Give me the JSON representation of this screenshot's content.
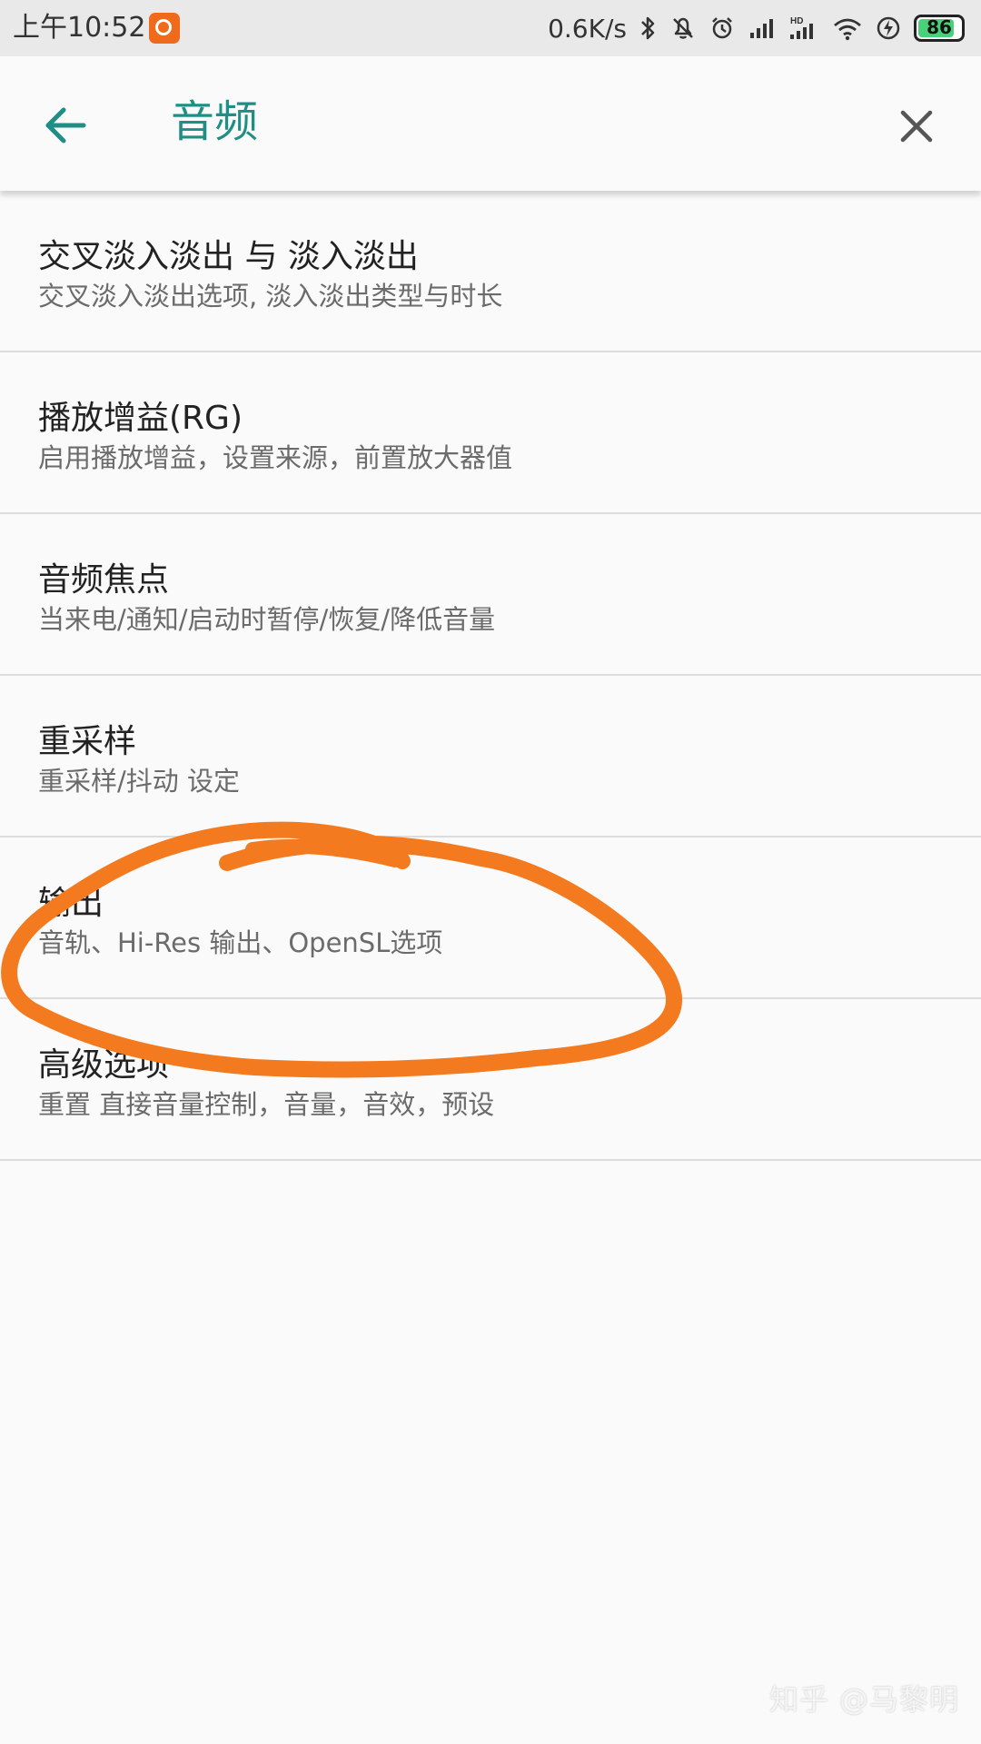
{
  "status_bar": {
    "time": "上午10:52",
    "app_icon": "mi-app-icon",
    "net_speed": "0.6K/s",
    "icons": [
      "bluetooth-icon",
      "bell-muted-icon",
      "alarm-icon",
      "signal-icon",
      "hd-signal-icon",
      "wifi-icon",
      "charging-icon",
      "battery-icon"
    ],
    "battery": "86",
    "battery_level_percent": 86
  },
  "app_bar": {
    "title": "音频",
    "back_icon": "arrow-left-icon",
    "close_icon": "close-icon",
    "accent_color": "#1f8f86"
  },
  "settings": {
    "items": [
      {
        "title": "交叉淡入淡出 与 淡入淡出",
        "subtitle": "交叉淡入淡出选项, 淡入淡出类型与时长"
      },
      {
        "title": "播放增益(RG)",
        "subtitle": "启用播放增益，设置来源，前置放大器值"
      },
      {
        "title": "音频焦点",
        "subtitle": "当来电/通知/启动时暂停/恢复/降低音量"
      },
      {
        "title": "重采样",
        "subtitle": "重采样/抖动 设定"
      },
      {
        "title": "输出",
        "subtitle": "音轨、Hi-Res 输出、OpenSL选项"
      },
      {
        "title": "高级选项",
        "subtitle": "重置 直接音量控制，音量，音效，预设"
      }
    ]
  },
  "annotation": {
    "color": "#f47a1f"
  },
  "watermark": "知乎 @马黎明"
}
